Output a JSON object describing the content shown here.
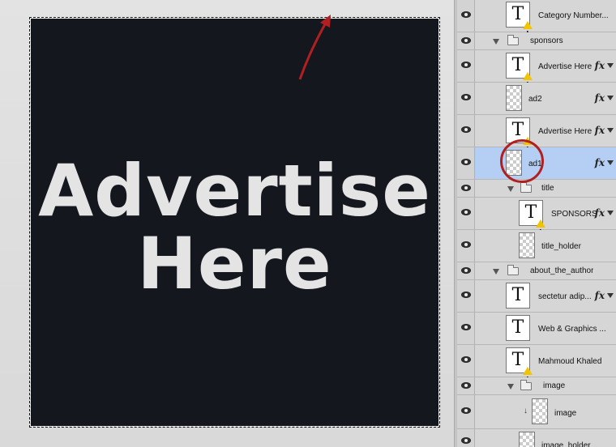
{
  "canvas": {
    "ad_line1": "Advertise",
    "ad_line2": "Here",
    "background_color": "#15171e",
    "annotation_color": "#b02020"
  },
  "layers": [
    {
      "name": "Category Number...",
      "kind": "text",
      "warning": true,
      "fx": false
    },
    {
      "name": "sponsors",
      "kind": "group"
    },
    {
      "name": "Advertise Here",
      "kind": "text",
      "warning": true,
      "fx": true
    },
    {
      "name": "ad2",
      "kind": "pixel",
      "fx": true
    },
    {
      "name": "Advertise Here",
      "kind": "text",
      "warning": true,
      "fx": true
    },
    {
      "name": "ad1",
      "kind": "pixel",
      "fx": true,
      "selected": true
    },
    {
      "name": "title",
      "kind": "group"
    },
    {
      "name": "SPONSORS",
      "kind": "text",
      "warning": true,
      "fx": true
    },
    {
      "name": "title_holder",
      "kind": "pixel",
      "fx": false
    },
    {
      "name": "about_the_author",
      "kind": "group"
    },
    {
      "name": "sectetur adip...",
      "kind": "text",
      "fx": true
    },
    {
      "name": "Web & Graphics ...",
      "kind": "text",
      "fx": false
    },
    {
      "name": "Mahmoud Khaled",
      "kind": "text",
      "warning": true,
      "fx": false
    },
    {
      "name": "image",
      "kind": "group"
    },
    {
      "name": "image",
      "kind": "pixel",
      "clipped": true,
      "fx": false
    },
    {
      "name": "image_holder",
      "kind": "pixel",
      "fx": false
    }
  ],
  "icons": {
    "visibility": "eye-icon",
    "fx": "fx-icon",
    "folder": "folder-icon",
    "warning": "warning-icon"
  },
  "fx_label": "fx"
}
